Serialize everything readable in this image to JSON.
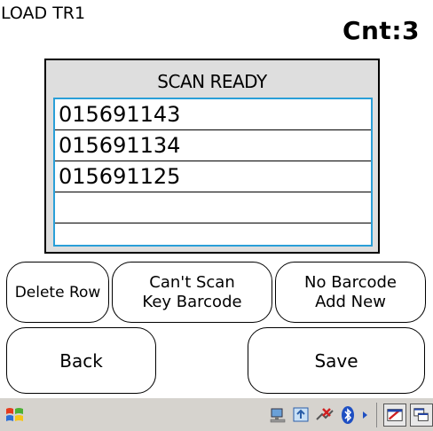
{
  "header": {
    "title": "LOAD TR1",
    "count": "Cnt:3"
  },
  "scan": {
    "status": "SCAN READY",
    "rows": [
      "015691143",
      "015691134",
      "015691125",
      ""
    ]
  },
  "buttons": {
    "delete_row": "Delete Row",
    "cant_scan": "Can't Scan\nKey Barcode",
    "no_barcode": "No Barcode\nAdd New",
    "back": "Back",
    "save": "Save"
  },
  "taskbar": {
    "icons": [
      "windows-start-icon",
      "network-icon",
      "sync-icon",
      "disconnected-icon",
      "bluetooth-icon",
      "tray-arrow-icon",
      "input-panel-icon",
      "switch-windows-icon"
    ],
    "colors": {
      "taskbar": "#d6d3ce",
      "list_border": "#2a9fd8"
    }
  }
}
